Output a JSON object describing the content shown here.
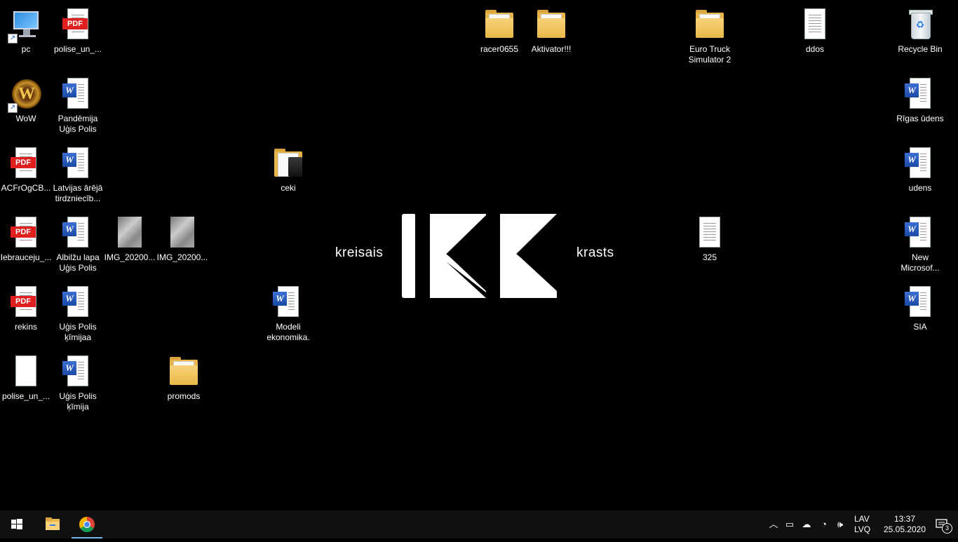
{
  "desktop": {
    "wallpaper": {
      "left_word": "kreisais",
      "right_word": "krasts",
      "logo_color": "#ffffff"
    },
    "icons": {
      "pc": "pc",
      "polise1": "polise_un_...",
      "racer": "racer0655",
      "aktivator": "Aktivator!!!",
      "ets": "Euro Truck\nSimulator 2",
      "ddos": "ddos",
      "recycle": "Recycle Bin",
      "wow": "WoW",
      "pandemija": "Pandēmija\nUģis Polis",
      "rigas": "Rīgas ūdens",
      "acfr": "ACFrOgCB...",
      "latvijas": "Latvijas ārējā\ntirdzniecīb...",
      "ceki": "ceki",
      "udens": "udens",
      "iebrauceju": "Iebrauceju_...",
      "albilzu": "Albilžu lapa\nUģis Polis",
      "img1": "IMG_20200...",
      "img2": "IMG_20200...",
      "n325": "325",
      "newms": "New\nMicrosof...",
      "rekins": "rekins",
      "kimijaa": "Uģis Polis\nķīmijaa",
      "modeli": "Modeli\nekonomika.",
      "sia": "SIA",
      "polise2": "polise_un_...",
      "kimija": "Uģis Polis\nķīmija",
      "promods": "promods"
    }
  },
  "taskbar": {
    "start_icon": "windows-logo",
    "apps": [
      "file-explorer",
      "chrome"
    ],
    "language_top": "LAV",
    "language_bottom": "LVQ",
    "time": "13:37",
    "date": "25.05.2020",
    "notification_count": "3",
    "accent": "#76b9ed"
  }
}
